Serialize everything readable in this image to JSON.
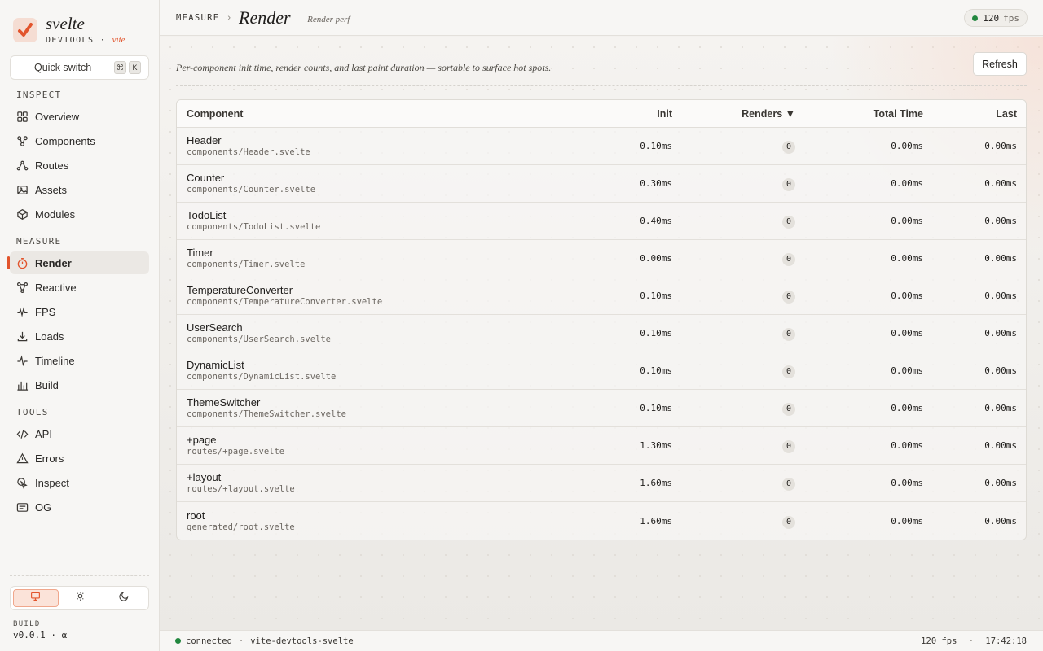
{
  "brand": {
    "name": "svelte",
    "sub": "DEVTOOLS",
    "sub_sep": "·",
    "vite": "vite"
  },
  "quick_switch": {
    "label": "Quick switch",
    "keys": [
      "⌘",
      "K"
    ]
  },
  "sections": {
    "inspect": "INSPECT",
    "measure": "MEASURE",
    "tools": "TOOLS"
  },
  "nav": {
    "overview": "Overview",
    "components": "Components",
    "routes": "Routes",
    "assets": "Assets",
    "modules": "Modules",
    "render": "Render",
    "reactive": "Reactive",
    "fps": "FPS",
    "loads": "Loads",
    "timeline": "Timeline",
    "build": "Build",
    "api": "API",
    "errors": "Errors",
    "inspect": "Inspect",
    "og": "OG"
  },
  "active_nav": "render",
  "build": {
    "label": "BUILD",
    "version": "v0.0.1 · α"
  },
  "header": {
    "crumb": "MEASURE",
    "crumb_sep": "›",
    "title": "Render",
    "subtitle": "— Render perf",
    "fps_value": "120",
    "fps_unit": "fps"
  },
  "main": {
    "description": "Per-component init time, render counts, and last paint duration — sortable to surface hot spots.",
    "refresh_label": "Refresh"
  },
  "table": {
    "columns": {
      "component": "Component",
      "init": "Init",
      "renders": "Renders ▼",
      "total": "Total Time",
      "last": "Last"
    },
    "rows": [
      {
        "name": "Header",
        "path": "components/Header.svelte",
        "init": "0.10ms",
        "renders": "0",
        "total": "0.00ms",
        "last": "0.00ms"
      },
      {
        "name": "Counter",
        "path": "components/Counter.svelte",
        "init": "0.30ms",
        "renders": "0",
        "total": "0.00ms",
        "last": "0.00ms"
      },
      {
        "name": "TodoList",
        "path": "components/TodoList.svelte",
        "init": "0.40ms",
        "renders": "0",
        "total": "0.00ms",
        "last": "0.00ms"
      },
      {
        "name": "Timer",
        "path": "components/Timer.svelte",
        "init": "0.00ms",
        "renders": "0",
        "total": "0.00ms",
        "last": "0.00ms"
      },
      {
        "name": "TemperatureConverter",
        "path": "components/TemperatureConverter.svelte",
        "init": "0.10ms",
        "renders": "0",
        "total": "0.00ms",
        "last": "0.00ms"
      },
      {
        "name": "UserSearch",
        "path": "components/UserSearch.svelte",
        "init": "0.10ms",
        "renders": "0",
        "total": "0.00ms",
        "last": "0.00ms"
      },
      {
        "name": "DynamicList",
        "path": "components/DynamicList.svelte",
        "init": "0.10ms",
        "renders": "0",
        "total": "0.00ms",
        "last": "0.00ms"
      },
      {
        "name": "ThemeSwitcher",
        "path": "components/ThemeSwitcher.svelte",
        "init": "0.10ms",
        "renders": "0",
        "total": "0.00ms",
        "last": "0.00ms"
      },
      {
        "name": "+page",
        "path": "routes/+page.svelte",
        "init": "1.30ms",
        "renders": "0",
        "total": "0.00ms",
        "last": "0.00ms"
      },
      {
        "name": "+layout",
        "path": "routes/+layout.svelte",
        "init": "1.60ms",
        "renders": "0",
        "total": "0.00ms",
        "last": "0.00ms"
      },
      {
        "name": "root",
        "path": "generated/root.svelte",
        "init": "1.60ms",
        "renders": "0",
        "total": "0.00ms",
        "last": "0.00ms"
      }
    ]
  },
  "footer": {
    "status": "connected",
    "sep": "·",
    "project": "vite-devtools-svelte",
    "fps": "120 fps",
    "time": "17:42:18"
  },
  "colors": {
    "accent": "#e2542c",
    "status_ok": "#22873f"
  },
  "icons": {
    "overview": "grid-icon",
    "components": "component-tree-icon",
    "routes": "route-icon",
    "assets": "image-icon",
    "modules": "cube-icon",
    "render": "stopwatch-icon",
    "reactive": "reactive-graph-icon",
    "fps": "pulse-icon",
    "loads": "download-icon",
    "timeline": "activity-icon",
    "build": "bar-chart-icon",
    "api": "code-icon",
    "errors": "warning-icon",
    "inspect": "cursor-inspect-icon",
    "og": "card-icon"
  }
}
